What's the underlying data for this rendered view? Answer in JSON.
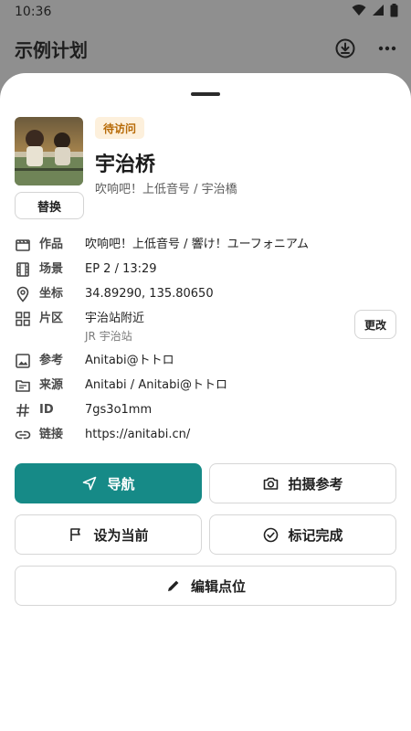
{
  "status_bar": {
    "time": "10:36"
  },
  "app_bar": {
    "title": "示例计划"
  },
  "sheet": {
    "badge": "待访问",
    "name": "宇治桥",
    "subtitle": "吹响吧！上低音号 / 宇治橋",
    "replace_label": "替换",
    "rows": {
      "work": {
        "label": "作品",
        "value": "吹响吧！上低音号 / 響け！ユーフォニアム"
      },
      "scene": {
        "label": "场景",
        "value": "EP 2 / 13:29"
      },
      "coords": {
        "label": "坐标",
        "value": "34.89290, 135.80650"
      },
      "area": {
        "label": "片区",
        "value": "宇治站附近",
        "detail": "JR 宇治站",
        "change_label": "更改"
      },
      "reference": {
        "label": "参考",
        "value": "Anitabi@トトロ"
      },
      "source": {
        "label": "来源",
        "value": "Anitabi / Anitabi@トトロ"
      },
      "id": {
        "label": "ID",
        "value": "7gs3o1mm"
      },
      "link": {
        "label": "链接",
        "value": "https://anitabi.cn/"
      }
    },
    "buttons": {
      "navigate": "导航",
      "photo_reference": "拍摄参考",
      "set_current": "设为当前",
      "mark_done": "标记完成",
      "edit_point": "编辑点位"
    }
  },
  "colors": {
    "accent": "#168a87",
    "badge_bg": "#fdf0dc",
    "badge_text": "#b76a07",
    "scrim": "#8f8f8f"
  },
  "icons": [
    "wifi-icon",
    "signal-icon",
    "battery-icon",
    "download-icon",
    "more-icon",
    "clapperboard-icon",
    "film-icon",
    "location-pin-icon",
    "grid-icon",
    "image-icon",
    "folder-icon",
    "hash-icon",
    "link-icon",
    "navigation-icon",
    "camera-icon",
    "flag-icon",
    "check-circle-icon",
    "pencil-icon"
  ]
}
